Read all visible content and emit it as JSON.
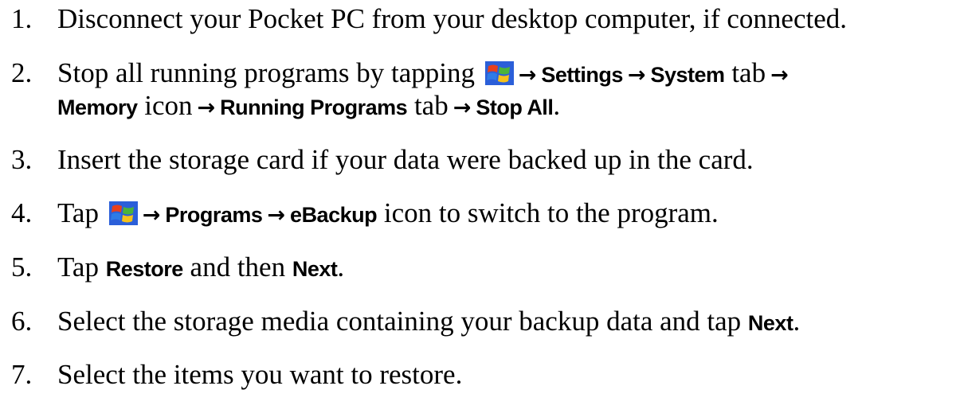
{
  "steps": [
    {
      "number": "1.",
      "parts": [
        {
          "t": "Disconnect your Pocket PC from your desktop computer, if connected."
        }
      ]
    },
    {
      "number": "2.",
      "line1": {
        "a": "Stop all running programs by tapping",
        "b": "Settings",
        "c": "System",
        "d": "tab"
      },
      "line2": {
        "a": "Memory",
        "b": "icon",
        "c": "Running Programs",
        "d": "tab",
        "e": "Stop All",
        "f": "."
      }
    },
    {
      "number": "3.",
      "text": "Insert the storage card if your data were backed up in the card."
    },
    {
      "number": "4.",
      "a": "Tap",
      "b": "Programs",
      "c": "eBackup",
      "d": "icon to switch to the program."
    },
    {
      "number": "5.",
      "a": "Tap",
      "b": "Restore",
      "c": "and then",
      "d": "Next",
      "e": "."
    },
    {
      "number": "6.",
      "a": "Select the storage media containing your backup data and tap",
      "b": "Next",
      "c": "."
    },
    {
      "number": "7.",
      "text": "Select the items you want to restore."
    }
  ],
  "arrow_glyph": "→",
  "icons": {
    "start": "windows-start-icon"
  }
}
